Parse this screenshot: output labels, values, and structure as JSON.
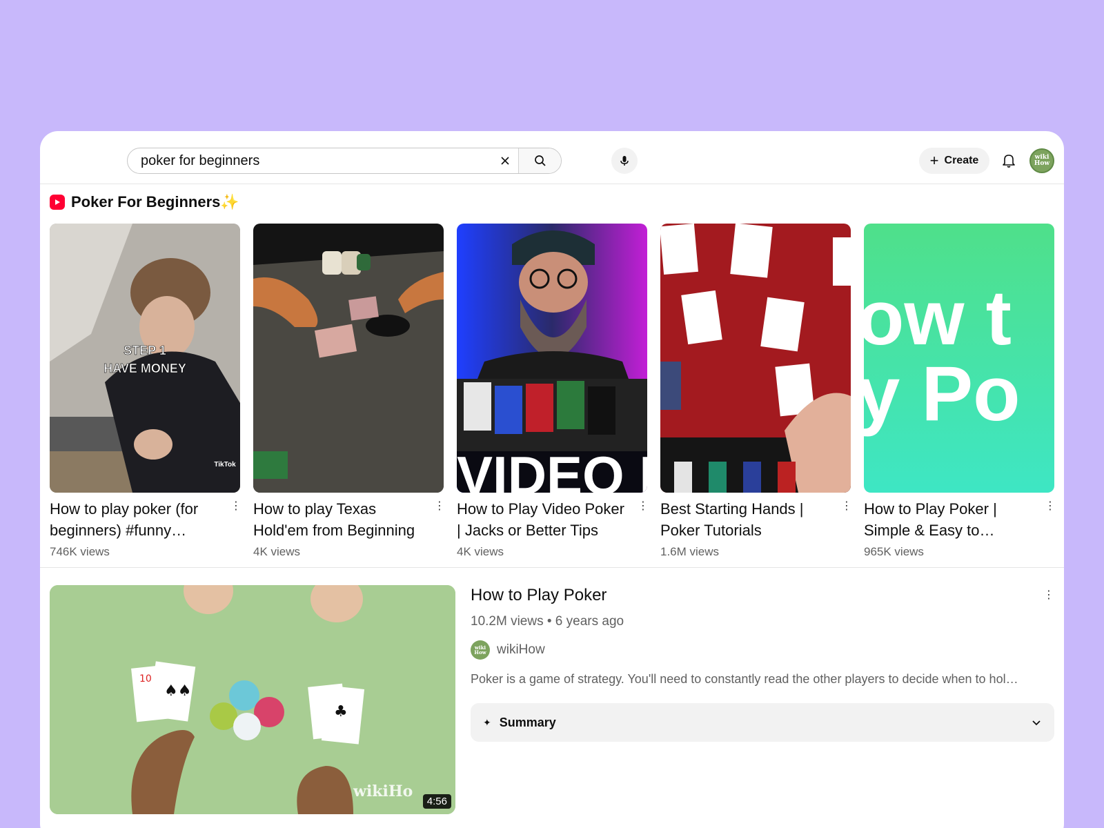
{
  "search": {
    "query": "poker for beginners"
  },
  "header": {
    "create_label": "Create",
    "avatar_text": "wiki How"
  },
  "shelf": {
    "title": "Poker For Beginners",
    "sparkle": "✨",
    "items": [
      {
        "title": "How to play poker (for beginners) #funny…",
        "views": "746K views",
        "overlay_line1": "STEP 1",
        "overlay_line2": "HAVE MONEY",
        "badge": "TikTok"
      },
      {
        "title": "How to play Texas Hold'em from Beginning",
        "views": "4K views"
      },
      {
        "title": "How to Play Video Poker | Jacks or Better Tips fo…",
        "views": "4K views",
        "overlay": "VIDEO P"
      },
      {
        "title": "Best Starting Hands | Poker Tutorials",
        "views": "1.6M views"
      },
      {
        "title": "How to Play Poker | Simple & Easy to…",
        "views": "965K views",
        "overlay_line1": "ow t",
        "overlay_line2": "y Po"
      }
    ]
  },
  "featured": {
    "title": "How to Play Poker",
    "meta": "10.2M views • 6 years ago",
    "channel": "wikiHow",
    "channel_avatar_text": "wiki How",
    "description": "Poker is a game of strategy. You'll need to constantly read the other players to decide when to hol…",
    "duration": "4:56",
    "watermark": "wikiHo",
    "summary_label": "Summary"
  },
  "colors": {
    "background": "#c8b8fb",
    "accent": "#ff0033",
    "thumb5": "#3ee6b4"
  },
  "icons": [
    "close-icon",
    "search-icon",
    "mic-icon",
    "plus-icon",
    "bell-icon",
    "more-vert-icon",
    "sparkle-icon",
    "chevron-down-icon"
  ]
}
